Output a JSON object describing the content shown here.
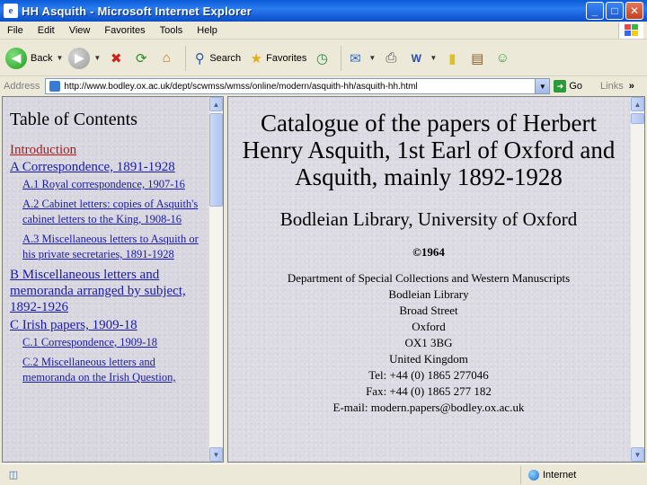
{
  "window": {
    "title": "HH Asquith - Microsoft Internet Explorer"
  },
  "menu": [
    "File",
    "Edit",
    "View",
    "Favorites",
    "Tools",
    "Help"
  ],
  "toolbar": {
    "back": "Back",
    "search": "Search",
    "favorites": "Favorites"
  },
  "address": {
    "label": "Address",
    "url": "http://www.bodley.ox.ac.uk/dept/scwmss/wmss/online/modern/asquith-hh/asquith-hh.html",
    "go": "Go",
    "links": "Links"
  },
  "toc": {
    "title": "Table of Contents",
    "introduction": "Introduction",
    "items": [
      {
        "label": "A  Correspondence, 1891-1928"
      },
      {
        "label": "A.1  Royal correspondence, 1907-16",
        "sub": true
      },
      {
        "label": "A.2  Cabinet letters: copies of Asquith's cabinet letters to the King, 1908-16",
        "sub": true
      },
      {
        "label": "A.3  Miscellaneous letters to Asquith or his private secretaries, 1891-1928",
        "sub": true
      },
      {
        "label": "B  Miscellaneous letters and memoranda arranged by subject, 1892-1926"
      },
      {
        "label": "C  Irish papers, 1909-18"
      },
      {
        "label": "C.1  Correspondence, 1909-18",
        "sub": true
      },
      {
        "label": "C.2  Miscellaneous letters and memoranda on the Irish Question,",
        "sub": true
      }
    ]
  },
  "main": {
    "heading": "Catalogue of the papers of Herbert Henry Asquith, 1st Earl of Oxford and Asquith, mainly 1892-1928",
    "subheading": "Bodleian Library, University of Oxford",
    "copyright": "©1964",
    "address_lines": [
      "Department of Special Collections and Western Manuscripts",
      "Bodleian Library",
      "Broad Street",
      "Oxford",
      "OX1 3BG",
      "United Kingdom",
      "Tel: +44 (0) 1865 277046",
      "Fax: +44 (0) 1865 277 182",
      "E-mail: modern.papers@bodley.ox.ac.uk"
    ]
  },
  "status": {
    "zone": "Internet"
  }
}
